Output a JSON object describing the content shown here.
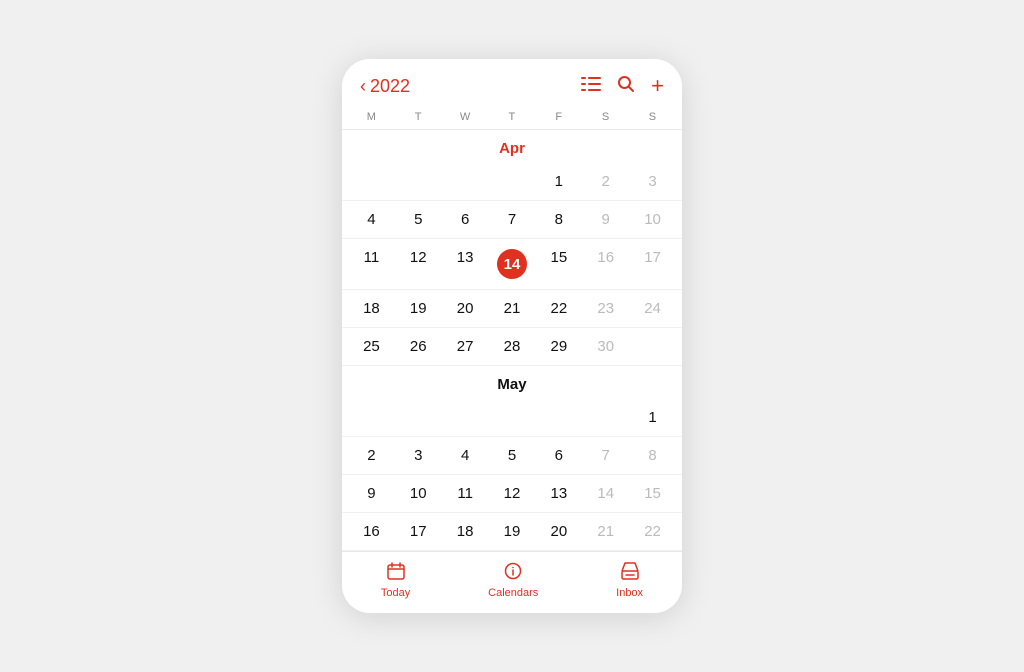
{
  "header": {
    "year": "2022",
    "chevron": "‹",
    "icons": [
      "list-icon",
      "search-icon",
      "add-icon"
    ]
  },
  "dayHeaders": [
    "M",
    "T",
    "W",
    "T",
    "F",
    "S",
    "S"
  ],
  "calendar": [
    {
      "month": "Apr",
      "monthClass": "red",
      "weeks": [
        [
          "",
          "",
          "",
          "",
          "1",
          "2",
          "3"
        ],
        [
          "4",
          "5",
          "6",
          "7",
          "8",
          "9",
          "10"
        ],
        [
          "11",
          "12",
          "13",
          "14",
          "15",
          "16",
          "17"
        ],
        [
          "18",
          "19",
          "20",
          "21",
          "22",
          "23",
          "24"
        ],
        [
          "25",
          "26",
          "27",
          "28",
          "29",
          "30",
          ""
        ]
      ],
      "mutedDays": [
        "2",
        "3",
        "9",
        "10",
        "16",
        "17",
        "23",
        "24",
        "30"
      ],
      "todayDay": "14",
      "emptyDays": [
        ""
      ]
    },
    {
      "month": "May",
      "monthClass": "black",
      "weeks": [
        [
          "",
          "",
          "",
          "",
          "",
          "",
          "1"
        ],
        [
          "2",
          "3",
          "4",
          "5",
          "6",
          "7",
          "8"
        ],
        [
          "9",
          "10",
          "11",
          "12",
          "13",
          "14",
          "15"
        ],
        [
          "16",
          "17",
          "18",
          "19",
          "20",
          "21",
          "22"
        ]
      ],
      "mutedDays": [
        "7",
        "8",
        "14",
        "15",
        "21",
        "22"
      ],
      "todayDay": "",
      "emptyDays": [
        ""
      ]
    }
  ],
  "tabBar": {
    "today": "Today",
    "calendars": "Calendars",
    "inbox": "Inbox"
  }
}
